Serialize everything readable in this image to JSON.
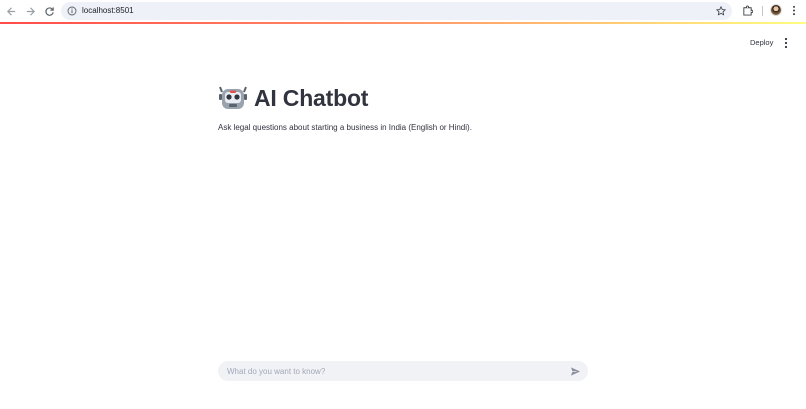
{
  "browser": {
    "url": "localhost:8501",
    "icons": {
      "back": "arrow-left-icon",
      "forward": "arrow-right-icon",
      "reload": "reload-icon",
      "info": "info-icon",
      "bookmark": "star-icon",
      "extensions": "puzzle-icon",
      "profile": "avatar",
      "menu": "kebab-menu-icon"
    }
  },
  "app": {
    "header": {
      "deploy_label": "Deploy"
    },
    "title": "AI Chatbot",
    "title_icon": "robot-icon",
    "subtitle": "Ask legal questions about starting a business in India (English or Hindi).",
    "chat": {
      "placeholder": "What do you want to know?",
      "value": ""
    }
  },
  "colors": {
    "accent_gradient_start": "#ff4b4b",
    "accent_gradient_end": "#fffd80",
    "text": "#31333f",
    "input_bg": "#f0f2f6"
  }
}
